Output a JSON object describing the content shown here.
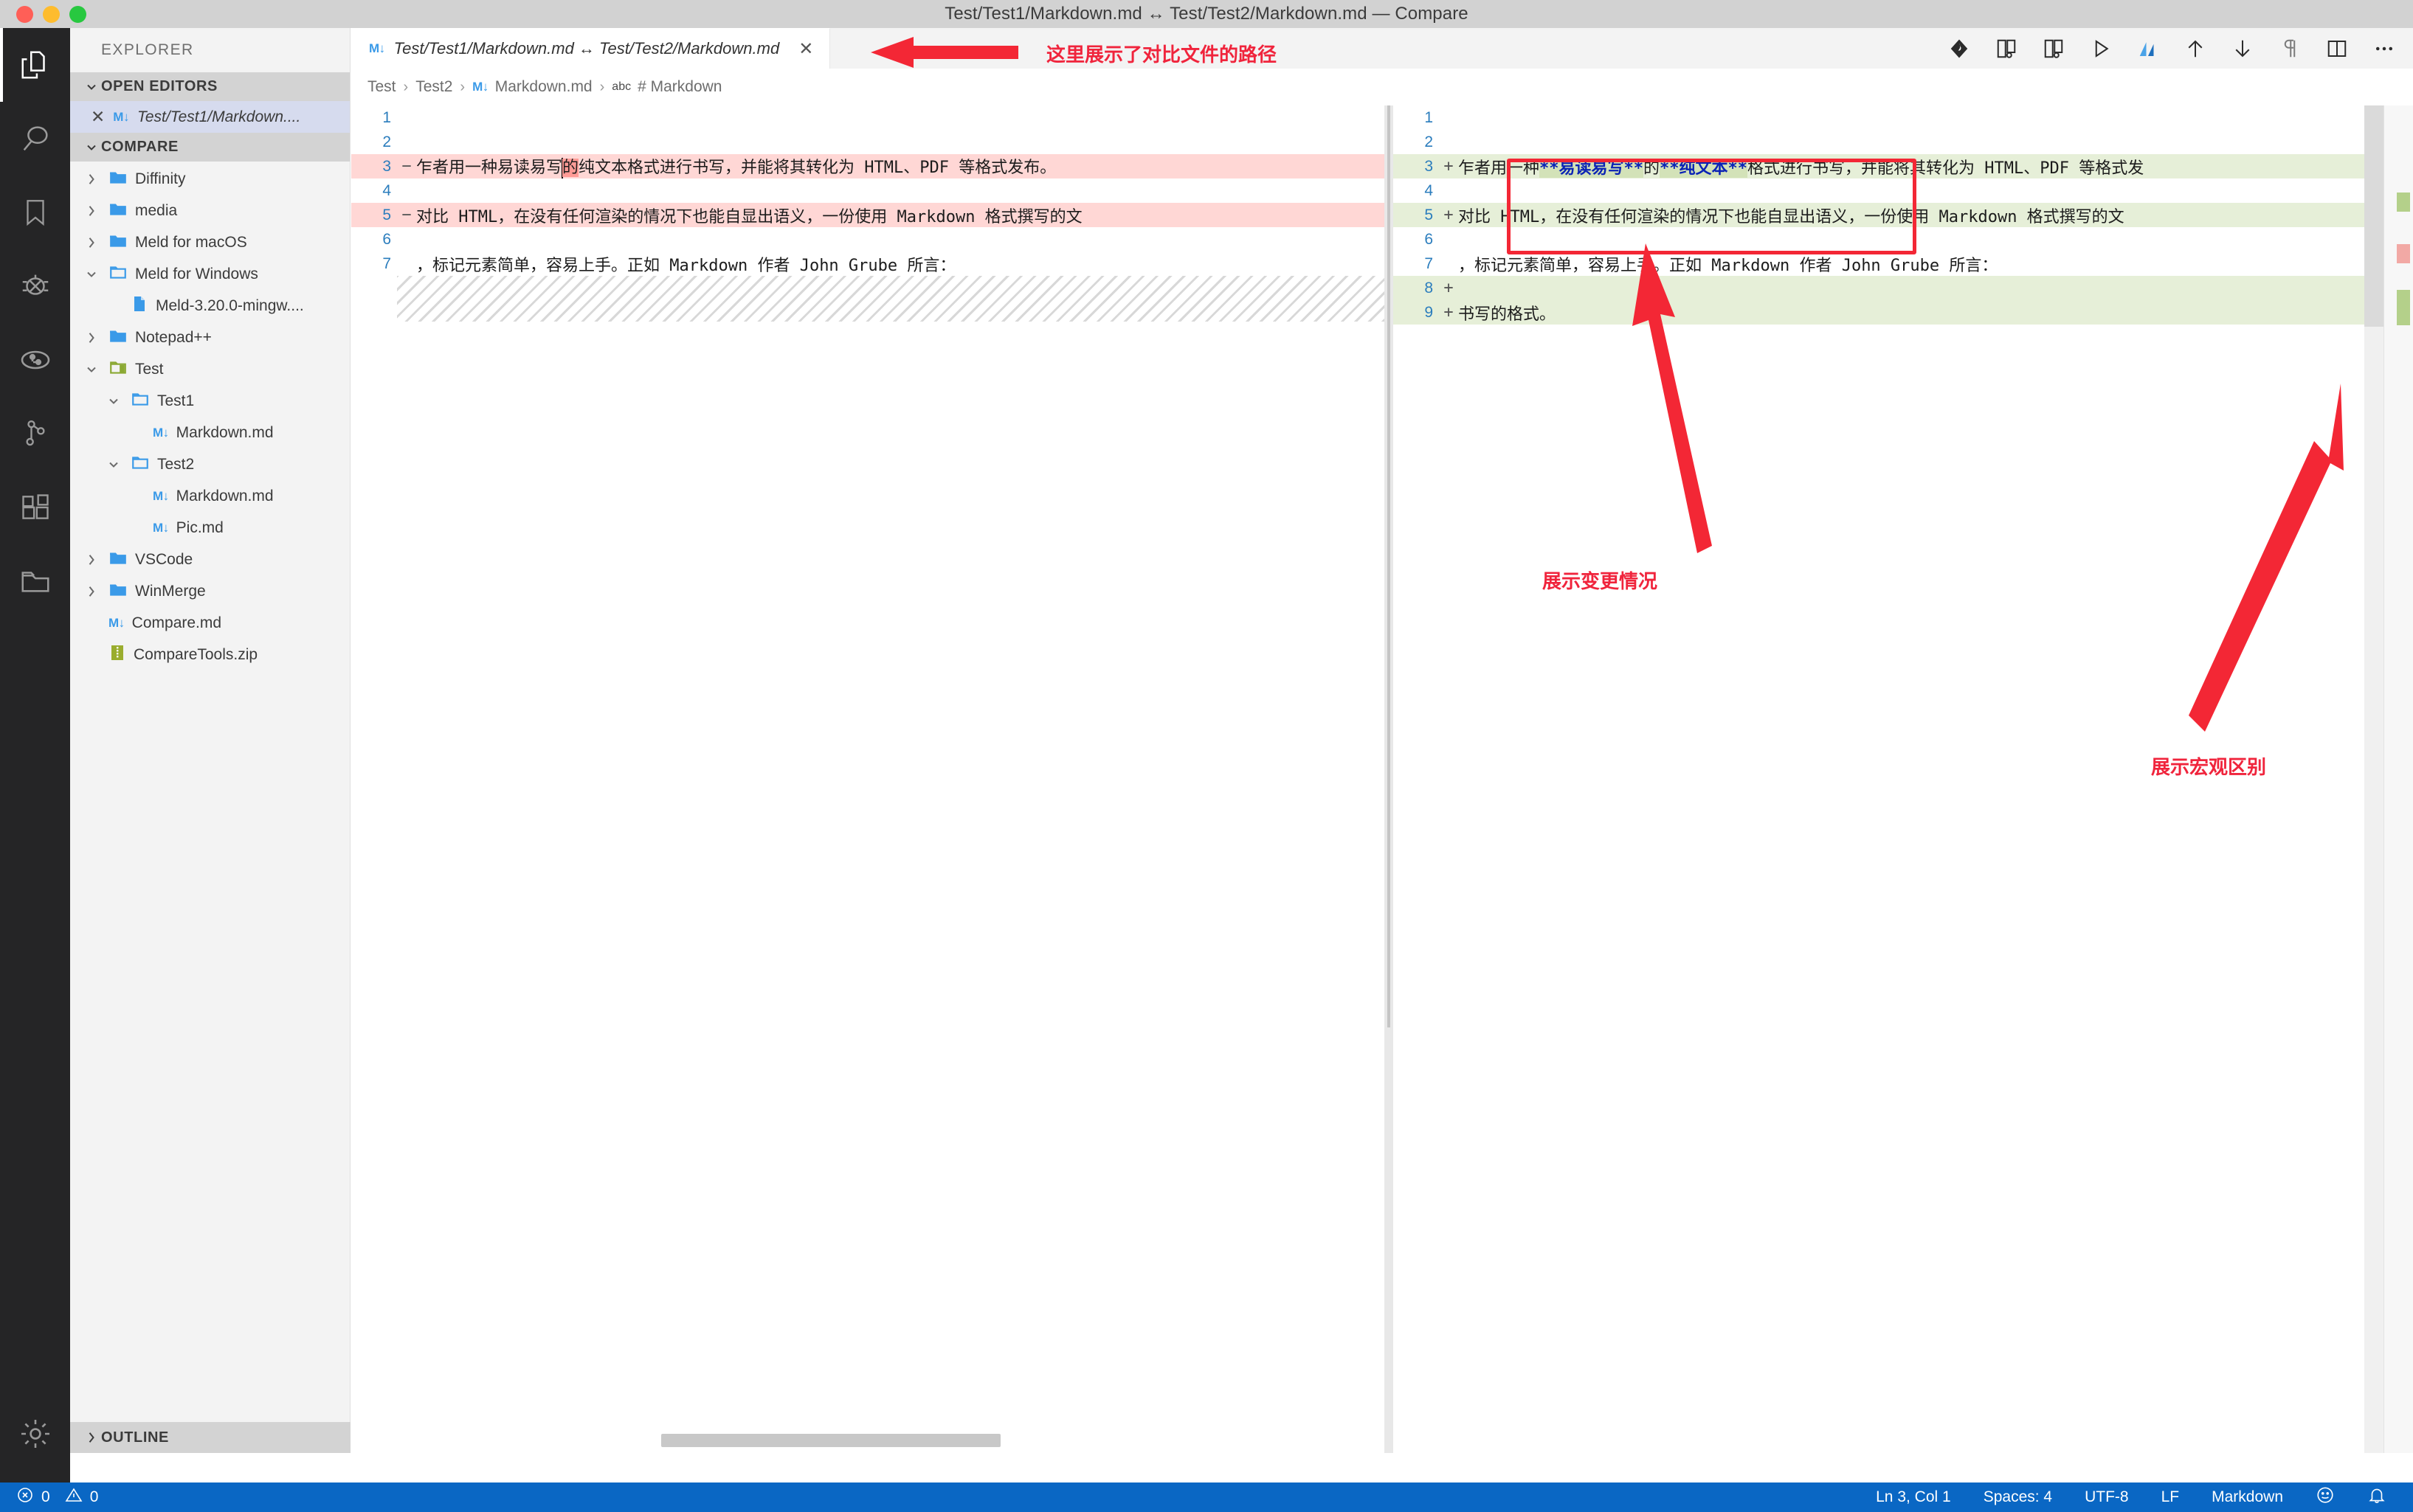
{
  "window": {
    "title": "Test/Test1/Markdown.md ↔ Test/Test2/Markdown.md — Compare"
  },
  "activitybar": {
    "items": [
      {
        "name": "explorer-icon",
        "label": "Explorer",
        "active": true
      },
      {
        "name": "search-icon",
        "label": "Search",
        "active": false
      },
      {
        "name": "bookmark-icon",
        "label": "Bookmarks",
        "active": false
      },
      {
        "name": "debug-icon",
        "label": "Run and Debug",
        "active": false
      },
      {
        "name": "source-control-circle-icon",
        "label": "Source Control",
        "active": false
      },
      {
        "name": "git-graph-icon",
        "label": "Git Graph",
        "active": false
      },
      {
        "name": "extensions-icon",
        "label": "Extensions",
        "active": false
      },
      {
        "name": "folder-icon",
        "label": "Folders",
        "active": false
      },
      {
        "name": "settings-gear-icon",
        "label": "Manage",
        "active": false
      }
    ]
  },
  "sidebar": {
    "title": "EXPLORER",
    "open_editors": {
      "header": "OPEN EDITORS",
      "items": [
        {
          "label": "Test/Test1/Markdown....",
          "icon": "markdown-icon",
          "active": true
        }
      ]
    },
    "compare": {
      "header": "COMPARE",
      "items": [
        {
          "label": "Diffinity",
          "type": "folder",
          "expanded": false,
          "depth": 1,
          "icon": "folder-blue-icon"
        },
        {
          "label": "media",
          "type": "folder",
          "expanded": false,
          "depth": 1,
          "icon": "folder-blue-icon"
        },
        {
          "label": "Meld for macOS",
          "type": "folder",
          "expanded": false,
          "depth": 1,
          "icon": "folder-blue-icon"
        },
        {
          "label": "Meld for Windows",
          "type": "folder",
          "expanded": true,
          "depth": 1,
          "icon": "folder-open-icon"
        },
        {
          "label": "Meld-3.20.0-mingw....",
          "type": "file",
          "depth": 2,
          "icon": "file-blue-icon"
        },
        {
          "label": "Notepad++",
          "type": "folder",
          "expanded": false,
          "depth": 1,
          "icon": "folder-blue-icon"
        },
        {
          "label": "Test",
          "type": "folder",
          "expanded": true,
          "depth": 1,
          "icon": "folder-green-icon"
        },
        {
          "label": "Test1",
          "type": "folder",
          "expanded": true,
          "depth": 2,
          "icon": "folder-open-icon"
        },
        {
          "label": "Markdown.md",
          "type": "file",
          "depth": 3,
          "icon": "markdown-icon"
        },
        {
          "label": "Test2",
          "type": "folder",
          "expanded": true,
          "depth": 2,
          "icon": "folder-open-icon"
        },
        {
          "label": "Markdown.md",
          "type": "file",
          "depth": 3,
          "icon": "markdown-icon"
        },
        {
          "label": "Pic.md",
          "type": "file",
          "depth": 3,
          "icon": "markdown-icon"
        },
        {
          "label": "VSCode",
          "type": "folder",
          "expanded": false,
          "depth": 1,
          "icon": "folder-blue-icon"
        },
        {
          "label": "WinMerge",
          "type": "folder",
          "expanded": false,
          "depth": 1,
          "icon": "folder-blue-icon"
        },
        {
          "label": "Compare.md",
          "type": "file",
          "depth": 1,
          "icon": "markdown-icon"
        },
        {
          "label": "CompareTools.zip",
          "type": "file",
          "depth": 1,
          "icon": "zip-icon"
        }
      ]
    },
    "outline": {
      "header": "OUTLINE"
    }
  },
  "editor": {
    "tab": {
      "label": "Test/Test1/Markdown.md ↔ Test/Test2/Markdown.md",
      "icon": "markdown-icon",
      "close": "✕"
    },
    "breadcrumb": [
      {
        "label": "Test",
        "icon": ""
      },
      {
        "label": "Test2",
        "icon": ""
      },
      {
        "label": "Markdown.md",
        "icon": "markdown-icon"
      },
      {
        "label": "# Markdown",
        "icon": "abc-icon"
      }
    ],
    "toolbar": [
      {
        "name": "diffinity-icon",
        "label": "Open in Diffinity"
      },
      {
        "name": "compare-left-icon",
        "label": "Compare with left"
      },
      {
        "name": "compare-right-icon",
        "label": "Compare with right"
      },
      {
        "name": "preview-play-icon",
        "label": "Open Preview"
      },
      {
        "name": "markdown-preview-icon",
        "label": "Markdown Preview"
      },
      {
        "name": "arrow-up-icon",
        "label": "Previous Change"
      },
      {
        "name": "arrow-down-icon",
        "label": "Next Change"
      },
      {
        "name": "pilcrow-icon",
        "label": "Toggle Whitespace"
      },
      {
        "name": "split-editor-icon",
        "label": "Split Editor"
      },
      {
        "name": "more-actions-icon",
        "label": "More Actions..."
      }
    ]
  },
  "diff": {
    "left": {
      "lines": [
        {
          "num": "1",
          "sign": "",
          "text": "",
          "kind": "normal"
        },
        {
          "num": "2",
          "sign": "",
          "text": "",
          "kind": "normal"
        },
        {
          "num": "3",
          "sign": "−",
          "kind": "del",
          "parts": [
            {
              "t": "乍者用一种易读易写",
              "w": false
            },
            {
              "t": "的",
              "w": true
            },
            {
              "t": "纯文本格式进行书写，并能将其转化为 HTML、PDF 等格式发布。",
              "w": false
            }
          ]
        },
        {
          "num": "4",
          "sign": "",
          "text": "",
          "kind": "normal"
        },
        {
          "num": "5",
          "sign": "−",
          "kind": "del",
          "parts": [
            {
              "t": "对比 HTML，在没有任何渲染的情况下也能自显出语义，一份使用 Markdown 格式撰写的文",
              "w": false
            }
          ]
        },
        {
          "num": "6",
          "sign": "",
          "text": "",
          "kind": "normal"
        },
        {
          "num": "7",
          "sign": "",
          "kind": "normal",
          "parts": [
            {
              "t": "，标记元素简单，容易上手。正如 Markdown 作者 John Grube 所言：",
              "w": false
            }
          ]
        }
      ],
      "filler": "hatched-region"
    },
    "right": {
      "lines": [
        {
          "num": "1",
          "sign": "",
          "text": "",
          "kind": "normal"
        },
        {
          "num": "2",
          "sign": "",
          "text": "",
          "kind": "normal"
        },
        {
          "num": "3",
          "sign": "+",
          "kind": "ins",
          "parts": [
            {
              "t": "乍者用一种",
              "w": false
            },
            {
              "t": "**易读易写**",
              "w": true,
              "bold": true
            },
            {
              "t": "的",
              "w": false
            },
            {
              "t": "**纯文本**",
              "w": true,
              "bold": true
            },
            {
              "t": "格式进行书写，并能将其转化为 HTML、PDF 等格式发",
              "w": false
            }
          ]
        },
        {
          "num": "4",
          "sign": "",
          "text": "",
          "kind": "normal"
        },
        {
          "num": "5",
          "sign": "+",
          "kind": "ins",
          "parts": [
            {
              "t": "对比 HTML，在没有任何渲染的情况下也能自显出语义，一份使用 Markdown 格式撰写的文",
              "w": false
            }
          ]
        },
        {
          "num": "6",
          "sign": "",
          "text": "",
          "kind": "normal"
        },
        {
          "num": "7",
          "sign": "",
          "kind": "normal",
          "parts": [
            {
              "t": "，标记元素简单，容易上手。正如 Markdown 作者 John Grube 所言：",
              "w": false
            }
          ]
        },
        {
          "num": "8",
          "sign": "+",
          "kind": "ins",
          "parts": [
            {
              "t": "",
              "w": false
            }
          ]
        },
        {
          "num": "9",
          "sign": "+",
          "kind": "ins",
          "parts": [
            {
              "t": "书写的格式。",
              "w": false
            }
          ]
        }
      ]
    }
  },
  "annotations": [
    {
      "name": "annotation-path",
      "text": "这里展示了对比文件的路径"
    },
    {
      "name": "annotation-changes",
      "text": "展示变更情况"
    },
    {
      "name": "annotation-overview",
      "text": "展示宏观区别"
    }
  ],
  "statusbar": {
    "errors": "0",
    "warnings": "0",
    "position": "Ln 3, Col 1",
    "indent": "Spaces: 4",
    "encoding": "UTF-8",
    "eol": "LF",
    "language": "Markdown",
    "feedback_icon": "smiley-icon",
    "bell_icon": "bell-icon"
  },
  "colors": {
    "accent": "#0a67c4",
    "deleted": "#ffd7d5",
    "inserted": "#e6efd8",
    "annotation": "#f0243c"
  }
}
